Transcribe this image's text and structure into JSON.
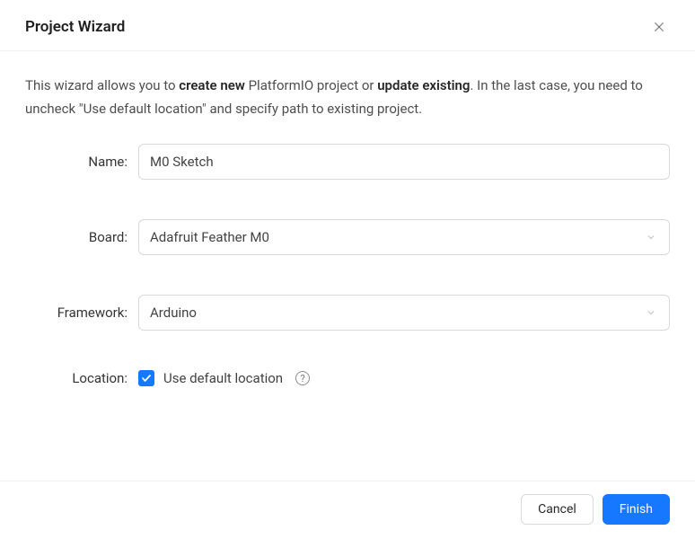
{
  "header": {
    "title": "Project Wizard"
  },
  "intro": {
    "part1": "This wizard allows you to ",
    "bold1": "create new",
    "part2": " PlatformIO project or ",
    "bold2": "update existing",
    "part3": ". In the last case, you need to uncheck \"Use default location\" and specify path to existing project."
  },
  "form": {
    "name": {
      "label": "Name:",
      "value": "M0 Sketch"
    },
    "board": {
      "label": "Board:",
      "value": "Adafruit Feather M0"
    },
    "framework": {
      "label": "Framework:",
      "value": "Arduino"
    },
    "location": {
      "label": "Location:",
      "checkbox_label": "Use default location",
      "checked": true
    }
  },
  "footer": {
    "cancel": "Cancel",
    "finish": "Finish"
  }
}
